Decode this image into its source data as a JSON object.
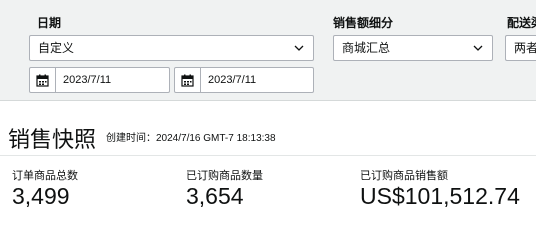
{
  "filters": {
    "date": {
      "label": "日期",
      "range_value": "自定义",
      "start_date": "2023/7/11",
      "end_date": "2023/7/11"
    },
    "sales_breakdown": {
      "label": "销售额细分",
      "value": "商城汇总"
    },
    "fulfillment": {
      "label": "配送渠",
      "value": "两者"
    }
  },
  "snapshot": {
    "title": "销售快照",
    "created_text": "创建时间：2024/7/16 GMT-7 18:13:38"
  },
  "metrics": [
    {
      "label": "订单商品总数",
      "value": "3,499"
    },
    {
      "label": "已订购商品数量",
      "value": "3,654"
    },
    {
      "label": "已订购商品销售额",
      "value": "US$101,512.74"
    }
  ],
  "icons": {
    "calendar": "calendar-icon",
    "dropdown": "chevron-down-icon"
  },
  "colors": {
    "panel_background": "#f0f2f2",
    "border": "#adb1b8",
    "text": "#0f1111"
  }
}
